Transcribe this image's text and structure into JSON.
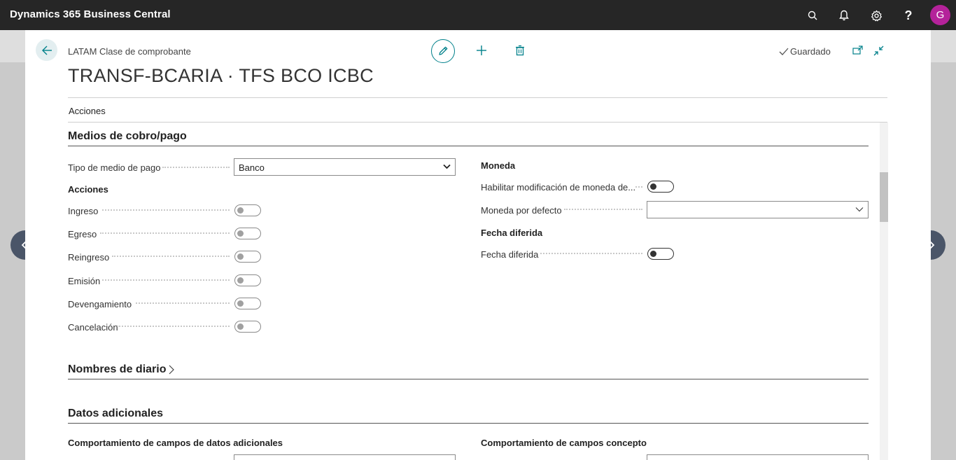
{
  "topbar": {
    "app_title": "Dynamics 365 Business Central",
    "avatar_initial": "G",
    "icons": [
      "search-icon",
      "bell-icon",
      "gear-icon",
      "help-icon"
    ]
  },
  "header": {
    "caption": "LATAM Clase de comprobante",
    "record_title": "TRANSF-BCARIA · TFS BCO ICBC",
    "saved_status": "Guardado",
    "actions_tab": "Acciones"
  },
  "sections": {
    "medios": {
      "title": "Medios de cobro/pago",
      "tipo_label": "Tipo de medio de pago",
      "tipo_value": "Banco",
      "acciones_title": "Acciones",
      "toggles": [
        {
          "label": "Ingreso",
          "value": false
        },
        {
          "label": "Egreso",
          "value": false
        },
        {
          "label": "Reingreso",
          "value": false
        },
        {
          "label": "Emisión",
          "value": false
        },
        {
          "label": "Devengamiento",
          "value": false
        },
        {
          "label": "Cancelación",
          "value": false
        }
      ],
      "moneda_title": "Moneda",
      "habilitar_label": "Habilitar modificación de moneda de...",
      "moneda_defecto_label": "Moneda por defecto",
      "moneda_defecto_value": "",
      "fecha_title": "Fecha diferida",
      "fecha_label": "Fecha diferida"
    },
    "nombres": {
      "title": "Nombres de diario"
    },
    "datos": {
      "title": "Datos adicionales",
      "comportamiento_adicionales": "Comportamiento de campos de datos adicionales",
      "comportamiento_concepto": "Comportamiento de campos concepto"
    }
  },
  "colors": {
    "topbar": "#262626",
    "accent": "#00808a",
    "avatar": "#b4229a",
    "nav_arrow": "#4a5568"
  }
}
